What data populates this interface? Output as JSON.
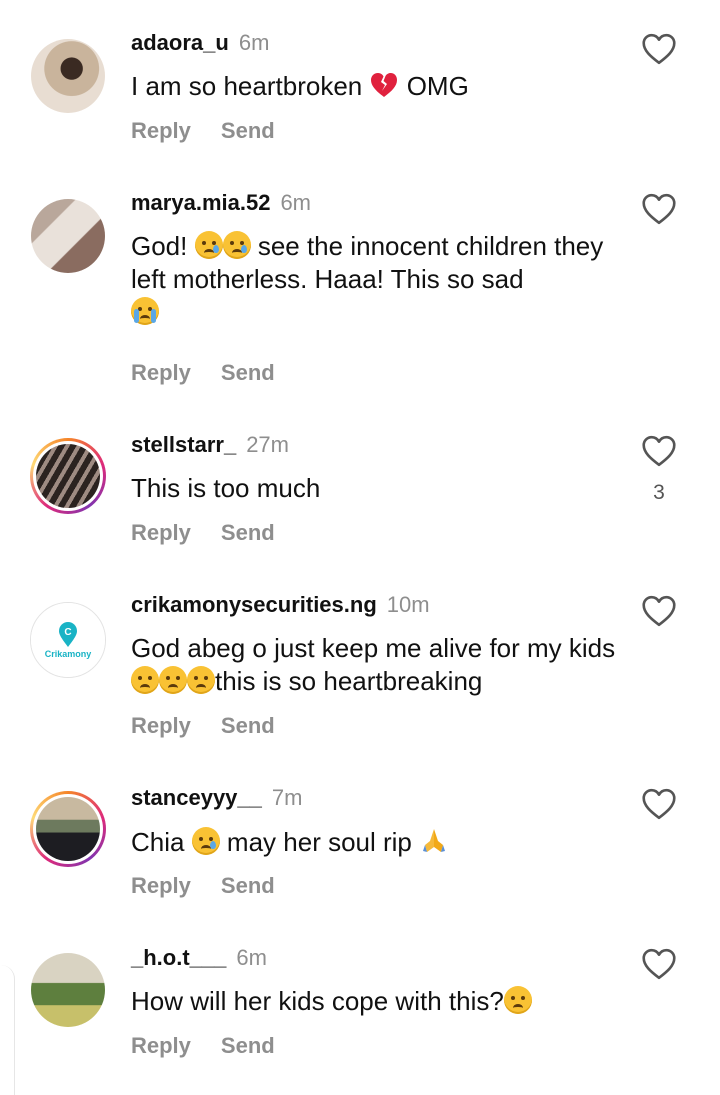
{
  "comments": [
    {
      "username": "adaora_u",
      "time": "6m",
      "text_parts": [
        "I am so heartbroken ",
        " OMG"
      ],
      "reply_label": "Reply",
      "send_label": "Send",
      "like_count": ""
    },
    {
      "username": "marya.mia.52",
      "time": "6m",
      "text_parts": [
        "God! ",
        " see the innocent children they left motherless. Haaa! This so sad"
      ],
      "reply_label": "Reply",
      "send_label": "Send",
      "like_count": ""
    },
    {
      "username": "stellstarr_",
      "time": "27m",
      "text_parts": [
        "This is too much"
      ],
      "reply_label": "Reply",
      "send_label": "Send",
      "like_count": "3"
    },
    {
      "username": "crikamonysecurities.ng",
      "time": "10m",
      "text_parts": [
        "God abeg o just keep me alive for my kids",
        "this is so heartbreaking"
      ],
      "reply_label": "Reply",
      "send_label": "Send",
      "like_count": "",
      "avatar_logo_text": "Crikamony"
    },
    {
      "username": "stanceyyy__",
      "time": "7m",
      "text_parts": [
        "Chia ",
        " may her soul rip "
      ],
      "reply_label": "Reply",
      "send_label": "Send",
      "like_count": ""
    },
    {
      "username": "_h.o.t___",
      "time": "6m",
      "text_parts": [
        "How will her kids cope with this?"
      ],
      "reply_label": "Reply",
      "send_label": "Send",
      "like_count": ""
    }
  ],
  "icons": {
    "like": "heart-outline-icon",
    "broken_heart": "broken-heart-icon",
    "crying_face": "crying-face-icon",
    "sobbing_face": "loudly-crying-face-icon",
    "weary_face": "weary-face-icon",
    "pray": "folded-hands-icon"
  },
  "colors": {
    "secondary_text": "#8e8e8e",
    "story_ring_start": "#f58529",
    "story_ring_end": "#dd2a7b",
    "brand_logo": "#19b3c5"
  }
}
